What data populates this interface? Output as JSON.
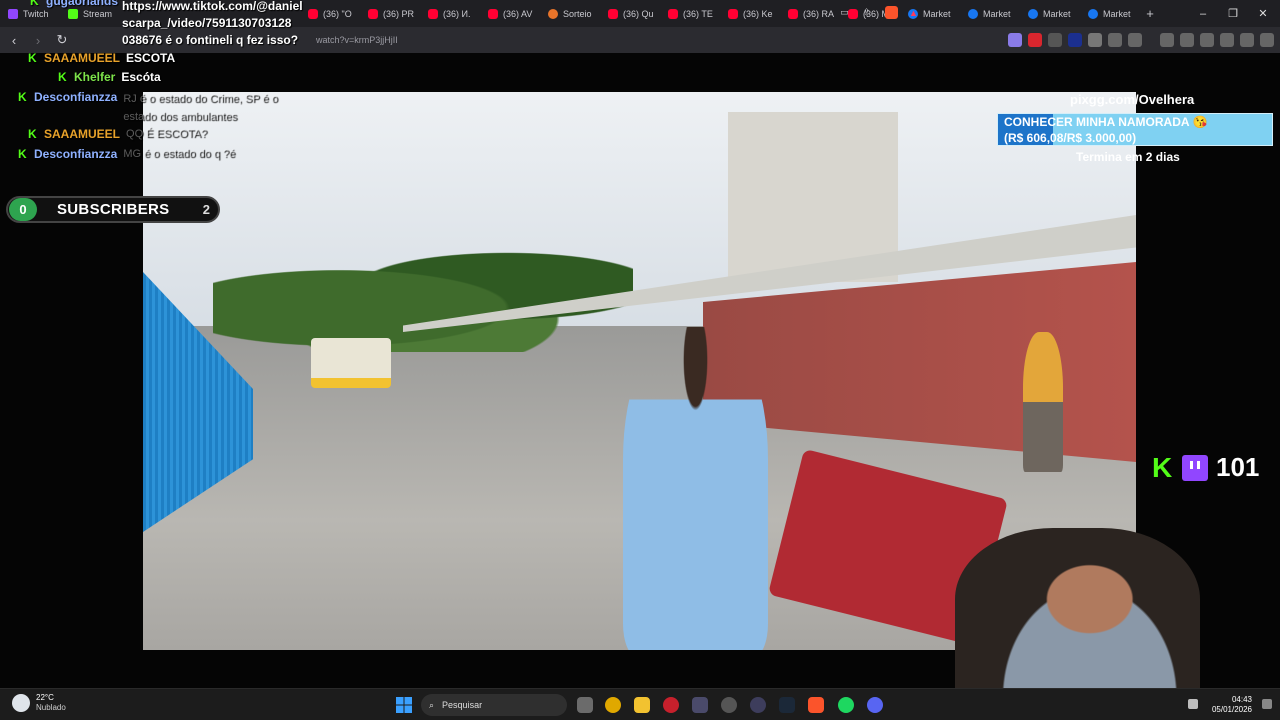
{
  "browser": {
    "tabs": [
      {
        "label": "Twitch",
        "favicon": "twitch-icon"
      },
      {
        "label": "Stream",
        "favicon": "kick-icon"
      },
      {
        "label": "(36) \"O",
        "favicon": "youtube-icon"
      },
      {
        "label": "(36) PR",
        "favicon": "youtube-icon"
      },
      {
        "label": "(36) И.",
        "favicon": "youtube-icon"
      },
      {
        "label": "(36) AV",
        "favicon": "youtube-icon"
      },
      {
        "label": "Sorteio",
        "favicon": "shop-icon"
      },
      {
        "label": "(36) Qu",
        "favicon": "youtube-icon"
      },
      {
        "label": "(36) TE",
        "favicon": "youtube-icon"
      },
      {
        "label": "(36) Ke",
        "favicon": "youtube-icon"
      },
      {
        "label": "(36) RA",
        "favicon": "youtube-icon"
      },
      {
        "label": "(36) MI",
        "favicon": "youtube-icon"
      },
      {
        "label": "Market",
        "favicon": "facebook-icon"
      },
      {
        "label": "Market",
        "favicon": "facebook-icon"
      },
      {
        "label": "Market",
        "favicon": "facebook-icon"
      },
      {
        "label": "Market",
        "favicon": "facebook-icon"
      }
    ],
    "new_tab": "+",
    "url_fragment": "watch?v=krmP3jjHjII"
  },
  "overlay": {
    "tiktok_text": "https://www.tiktok.com/@daniel scarpa_/video/7591130703128 038676 é o fontineli q fez isso?",
    "top_user": "gugaorlands",
    "chat": [
      {
        "user": "SAAAMUEEL",
        "message": "ESCOTA",
        "color": "orange",
        "faded": false
      },
      {
        "user": "Khelfer",
        "message": "Escóta",
        "color": "green",
        "faded": false
      },
      {
        "user": "Desconfianzza",
        "message": "RJ é o estado do Crime, SP é o estado dos ambulantes",
        "color": "blue",
        "faded": true
      },
      {
        "user": "SAAAMUEEL",
        "message": "QQ É ESCOTA?",
        "color": "orange",
        "faded": true
      },
      {
        "user": "Desconfianzza",
        "message": "MG é o estado do q ?é",
        "color": "blue",
        "faded": true
      }
    ],
    "subscribers": {
      "count": "0",
      "label": "SUBSCRIBERS",
      "goal": "2"
    },
    "donation": {
      "link": "pixgg.com/Ovelhera",
      "title": "CONHECER MINHA NAMORADA 😘",
      "amount": "(R$ 606,08/R$ 3.000,00)",
      "progress": 0.202,
      "ends": "Termina em 2 dias"
    },
    "viewers": {
      "count": "101"
    }
  },
  "taskbar": {
    "weather_temp": "22°C",
    "weather_desc": "Nublado",
    "search_placeholder": "Pesquisar",
    "time": "04:43",
    "date": "05/01/2026"
  },
  "colors": {
    "kick": "#53fc18",
    "twitch": "#9146ff",
    "goal_fill": "#1d74c9",
    "goal_bg": "#7fd1f2"
  }
}
